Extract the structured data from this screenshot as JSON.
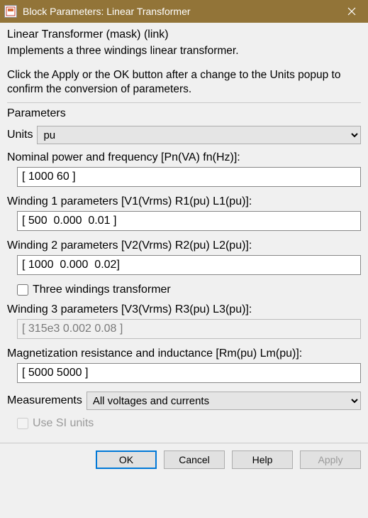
{
  "titlebar": {
    "title": "Block Parameters: Linear Transformer"
  },
  "mask_link": "Linear Transformer (mask) (link)",
  "description_line1": "Implements a three windings linear transformer.",
  "description_line2": "Click the Apply or the OK button after a change to the Units popup to confirm the conversion of parameters.",
  "section_title": "Parameters",
  "units": {
    "label": "Units",
    "value": "pu"
  },
  "nominal": {
    "label": "Nominal power and frequency [Pn(VA) fn(Hz)]:",
    "value": "[ 1000 60 ]"
  },
  "winding1": {
    "label": "Winding 1 parameters [V1(Vrms) R1(pu) L1(pu)]:",
    "value": "[ 500  0.000  0.01 ]"
  },
  "winding2": {
    "label": "Winding 2 parameters [V2(Vrms) R2(pu) L2(pu)]:",
    "value": "[ 1000  0.000  0.02]"
  },
  "three_windings": {
    "label": "Three windings transformer",
    "checked": false
  },
  "winding3": {
    "label": "Winding 3 parameters [V3(Vrms) R3(pu) L3(pu)]:",
    "value": "[ 315e3 0.002 0.08 ]"
  },
  "magnetization": {
    "label": "Magnetization resistance and inductance [Rm(pu) Lm(pu)]:",
    "value": "[ 5000 5000 ]"
  },
  "measurements": {
    "label": "Measurements",
    "value": "All voltages and currents"
  },
  "use_si": {
    "label": "Use SI units",
    "checked": false
  },
  "buttons": {
    "ok": "OK",
    "cancel": "Cancel",
    "help": "Help",
    "apply": "Apply"
  }
}
